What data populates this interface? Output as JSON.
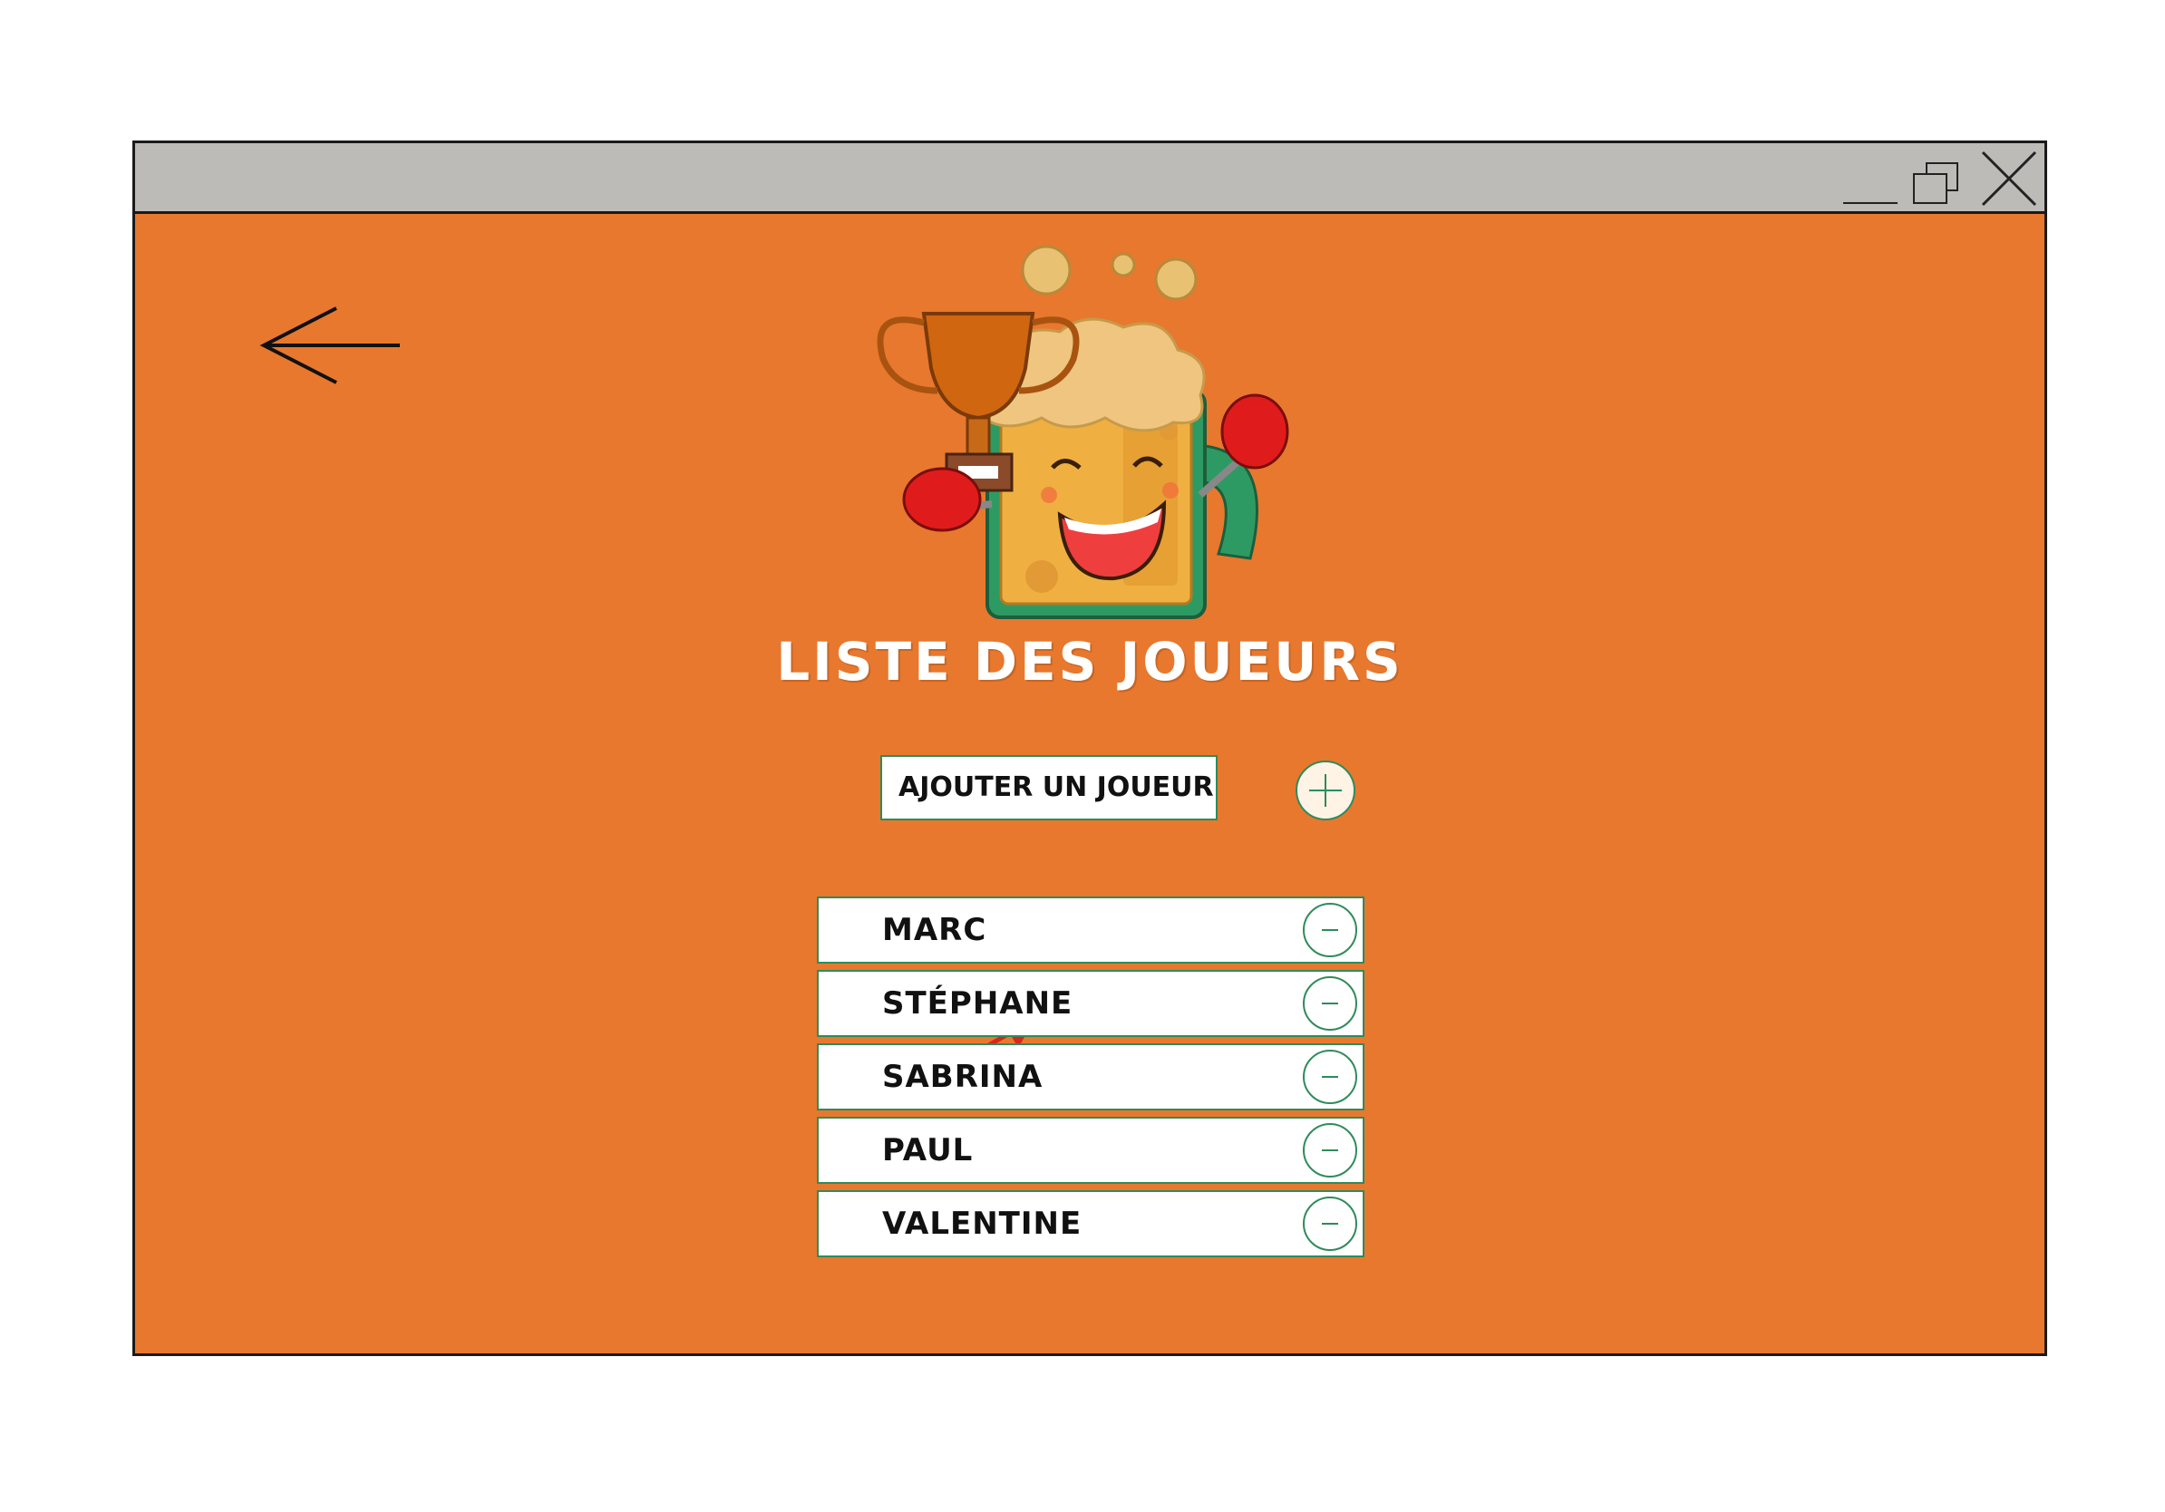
{
  "page": {
    "title": "LISTE DES JOUEURS"
  },
  "window": {
    "controls": [
      "minimize-icon",
      "restore-icon",
      "close-icon"
    ]
  },
  "nav": {
    "back_icon": "arrow-left-icon"
  },
  "add_player": {
    "input_value": "AJOUTER UN JOUEUR",
    "add_icon": "plus-icon"
  },
  "players": [
    {
      "name": "MARC"
    },
    {
      "name": "STÉPHANE"
    },
    {
      "name": "SABRINA"
    },
    {
      "name": "PAUL"
    },
    {
      "name": "VALENTINE"
    }
  ],
  "colors": {
    "background": "#e8782e",
    "titlebar": "#bcbbb8",
    "accent_green": "#2f8b5c",
    "annotation_red": "#d9261c"
  }
}
